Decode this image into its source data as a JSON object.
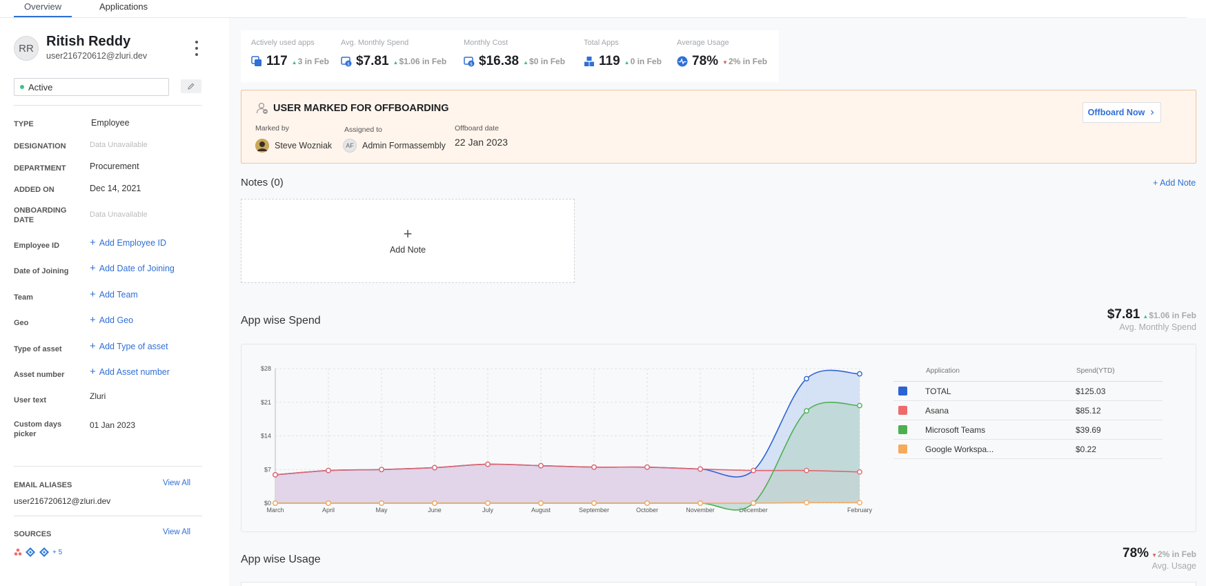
{
  "tabs": [
    {
      "label": "Overview",
      "active": true
    },
    {
      "label": "Applications",
      "active": false
    }
  ],
  "user": {
    "initials": "RR",
    "name": "Ritish Reddy",
    "email": "user216720612@zluri.dev",
    "status": "Active"
  },
  "properties": [
    {
      "label": "TYPE",
      "value": "Employee",
      "kind": "value"
    },
    {
      "label": "DESIGNATION",
      "value": "Data Unavailable",
      "kind": "na"
    },
    {
      "label": "DEPARTMENT",
      "value": "Procurement",
      "kind": "value"
    },
    {
      "label": "ADDED ON",
      "value": "Dec 14, 2021",
      "kind": "value"
    },
    {
      "label": "ONBOARDING DATE",
      "value": "Data Unavailable",
      "kind": "na"
    },
    {
      "label": "Employee ID",
      "value": "Add Employee ID",
      "kind": "link"
    },
    {
      "label": "Date of Joining",
      "value": "Add Date of Joining",
      "kind": "link"
    },
    {
      "label": "Team",
      "value": "Add Team",
      "kind": "link"
    },
    {
      "label": "Geo",
      "value": "Add Geo",
      "kind": "link"
    },
    {
      "label": "Type of asset",
      "value": "Add Type of asset",
      "kind": "link"
    },
    {
      "label": "Asset number",
      "value": "Add Asset number",
      "kind": "link"
    },
    {
      "label": "User text",
      "value": "Zluri",
      "kind": "value"
    },
    {
      "label": "Custom days picker",
      "value": "01 Jan 2023",
      "kind": "value"
    }
  ],
  "email_aliases": {
    "title": "EMAIL ALIASES",
    "view_all": "View All",
    "items": [
      "user216720612@zluri.dev"
    ]
  },
  "sources": {
    "title": "SOURCES",
    "view_all": "View All",
    "more": "+ 5"
  },
  "stats": [
    {
      "label": "Actively used apps",
      "value": "117",
      "change": "3 in Feb",
      "trend": "up",
      "icon": "apps-icon"
    },
    {
      "label": "Avg. Monthly Spend",
      "value": "$7.81",
      "change": "$1.06 in Feb",
      "trend": "up",
      "icon": "spend-icon"
    },
    {
      "label": "Monthly Cost",
      "value": "$16.38",
      "change": "$0 in Feb",
      "trend": "up",
      "icon": "cost-icon"
    },
    {
      "label": "Total Apps",
      "value": "119",
      "change": "0 in Feb",
      "trend": "up",
      "icon": "total-apps-icon"
    },
    {
      "label": "Average Usage",
      "value": "78%",
      "change": "2% in Feb",
      "trend": "down",
      "icon": "usage-icon"
    }
  ],
  "offboarding": {
    "title": "USER MARKED FOR OFFBOARDING",
    "marked_by_label": "Marked by",
    "marked_by": "Steve Wozniak",
    "assigned_to_label": "Assigned to",
    "assigned_to_initials": "AF",
    "assigned_to": "Admin Formassembly",
    "date_label": "Offboard date",
    "date": "22 Jan 2023",
    "button": "Offboard Now"
  },
  "notes": {
    "title": "Notes (0)",
    "add_link": "+ Add Note",
    "add_box": "Add Note"
  },
  "app_spend": {
    "title": "App wise Spend",
    "metric": "$7.81",
    "metric_change": "$1.06 in Feb",
    "metric_trend": "up",
    "metric_label": "Avg. Monthly Spend",
    "table_headers": [
      "Application",
      "Spend(YTD)"
    ],
    "rows": [
      {
        "name": "TOTAL",
        "spend": "$125.03",
        "color": "#2c63d3"
      },
      {
        "name": "Asana",
        "spend": "$85.12",
        "color": "#ee6b6b"
      },
      {
        "name": "Microsoft Teams",
        "spend": "$39.69",
        "color": "#4caf50"
      },
      {
        "name": "Google Workspa...",
        "spend": "$0.22",
        "color": "#f7a95c"
      }
    ]
  },
  "app_usage": {
    "title": "App wise Usage",
    "metric": "78%",
    "metric_change": "2% in Feb",
    "metric_trend": "down",
    "metric_label": "Avg. Usage"
  },
  "chart_data": {
    "type": "area",
    "x": [
      "March",
      "April",
      "May",
      "June",
      "July",
      "August",
      "September",
      "October",
      "November",
      "December",
      "January",
      "February"
    ],
    "x_tick_labels": [
      "March",
      "April",
      "May",
      "June",
      "July",
      "August",
      "September",
      "October",
      "November",
      "December",
      "",
      "February"
    ],
    "y_ticks": [
      "$0",
      "$7",
      "$14",
      "$21",
      "$28"
    ],
    "ylim": [
      0,
      28
    ],
    "grid": true,
    "series": [
      {
        "name": "TOTAL",
        "color": "#2c63d3",
        "fill": "#c9d8f3",
        "values": [
          5.9,
          6.8,
          7.0,
          7.4,
          8.1,
          7.8,
          7.5,
          7.5,
          7.1,
          6.8,
          25.9,
          26.9
        ]
      },
      {
        "name": "Asana",
        "color": "#e0666f",
        "fill": "#e5cfe4",
        "values": [
          5.9,
          6.8,
          7.0,
          7.4,
          8.1,
          7.8,
          7.5,
          7.5,
          7.1,
          6.8,
          6.8,
          6.5
        ]
      },
      {
        "name": "Microsoft Teams",
        "color": "#4caf50",
        "fill": "#b9d6cf",
        "values": [
          0,
          0,
          0,
          0,
          0,
          0,
          0,
          0,
          0,
          0,
          19.2,
          20.3
        ]
      },
      {
        "name": "Google Workspa...",
        "color": "#f7a95c",
        "fill": "none",
        "values": [
          0,
          0,
          0,
          0,
          0,
          0,
          0,
          0,
          0,
          0,
          0.1,
          0.1
        ]
      }
    ]
  }
}
